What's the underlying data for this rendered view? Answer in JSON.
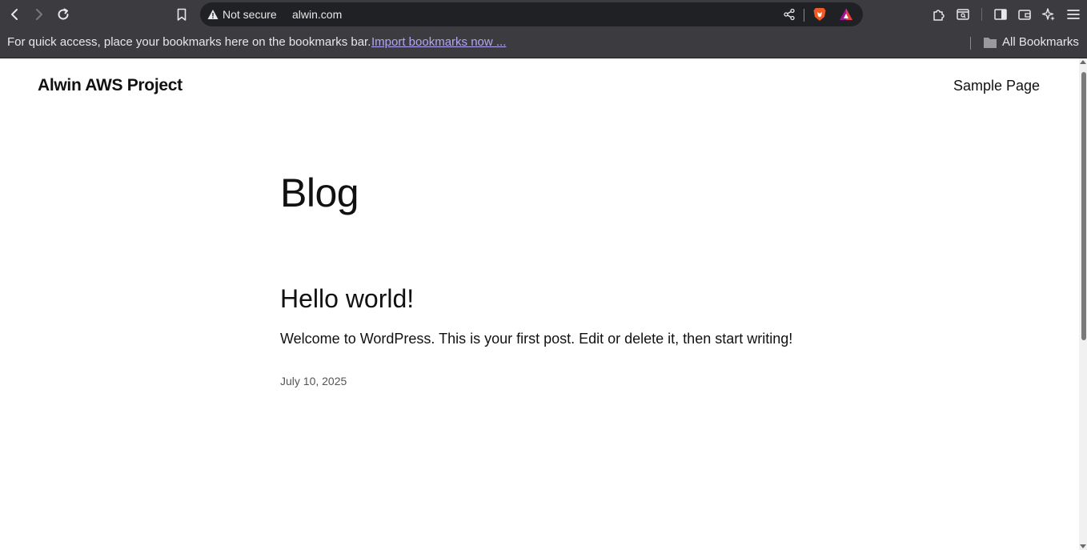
{
  "browser": {
    "security_label": "Not secure",
    "url": "alwin.com",
    "bookmarks_prompt": "For quick access, place your bookmarks here on the bookmarks bar.",
    "import_link": "Import bookmarks now ...",
    "all_bookmarks": "All Bookmarks",
    "icons": [
      "back-icon",
      "forward-icon",
      "reload-icon",
      "bookmark-icon",
      "warning-icon",
      "share-icon",
      "brave-shields-icon",
      "brave-rewards-icon",
      "extensions-icon",
      "tab-search-icon",
      "sidebar-icon",
      "wallet-icon",
      "leo-ai-icon",
      "menu-icon",
      "folder-icon"
    ]
  },
  "site": {
    "title": "Alwin AWS Project",
    "nav": [
      "Sample Page"
    ]
  },
  "page": {
    "heading": "Blog",
    "posts": [
      {
        "title": "Hello world!",
        "excerpt": "Welcome to WordPress. This is your first post. Edit or delete it, then start writing!",
        "date": "July 10, 2025"
      }
    ]
  },
  "colors": {
    "chrome": "#3b3b40",
    "urlbar": "#202124",
    "link": "#b3a6f2",
    "page_bg": "#ffffff",
    "text": "#111111"
  }
}
